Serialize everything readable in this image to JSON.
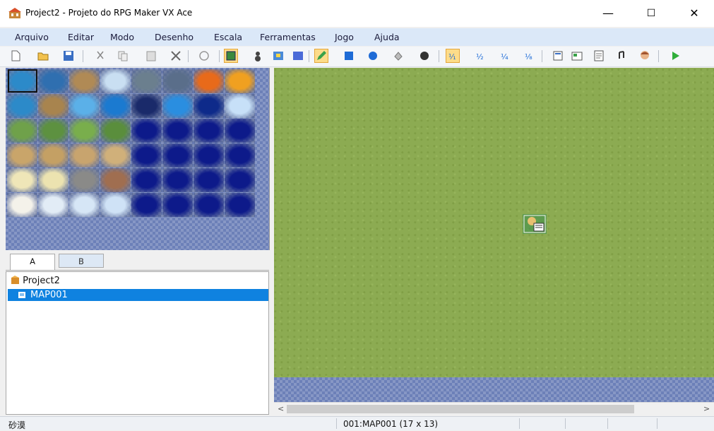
{
  "window": {
    "title": "Project2 - Projeto do RPG Maker VX Ace",
    "minimize": "—",
    "maximize": "☐",
    "close": "✕"
  },
  "menu": [
    "Arquivo",
    "Editar",
    "Modo",
    "Desenho",
    "Escala",
    "Ferramentas",
    "Jogo",
    "Ajuda"
  ],
  "toolbar": {
    "icons": [
      "new-project-icon",
      "open-project-icon",
      "save-project-icon",
      "cut-icon",
      "copy-icon",
      "paste-icon",
      "delete-icon",
      "undo-icon",
      "map-layer-icon",
      "event-layer-icon",
      "region-icon",
      "pencil-icon",
      "rectangle-icon",
      "ellipse-icon",
      "fill-icon",
      "shadow-pen-icon",
      "scale-1-1-icon",
      "scale-1-2-icon",
      "scale-1-4-icon",
      "scale-1-8-icon",
      "database-icon",
      "resource-manager-icon",
      "script-editor-icon",
      "sound-test-icon",
      "character-generator-icon",
      "playtest-icon"
    ]
  },
  "tileset": {
    "tabs": [
      "A",
      "B"
    ],
    "active_tab": "A"
  },
  "tree": {
    "root": "Project2",
    "selected_map": "MAP001"
  },
  "map": {
    "scroll_left": "<",
    "scroll_right": ">"
  },
  "status": {
    "left": "砂漠",
    "map_info": "001:MAP001 (17 x 13)"
  },
  "colors": {
    "menubar": "#dbe8f8",
    "selection": "#0f82e0",
    "grass": "#8cab52",
    "water": "#6c80b8"
  }
}
